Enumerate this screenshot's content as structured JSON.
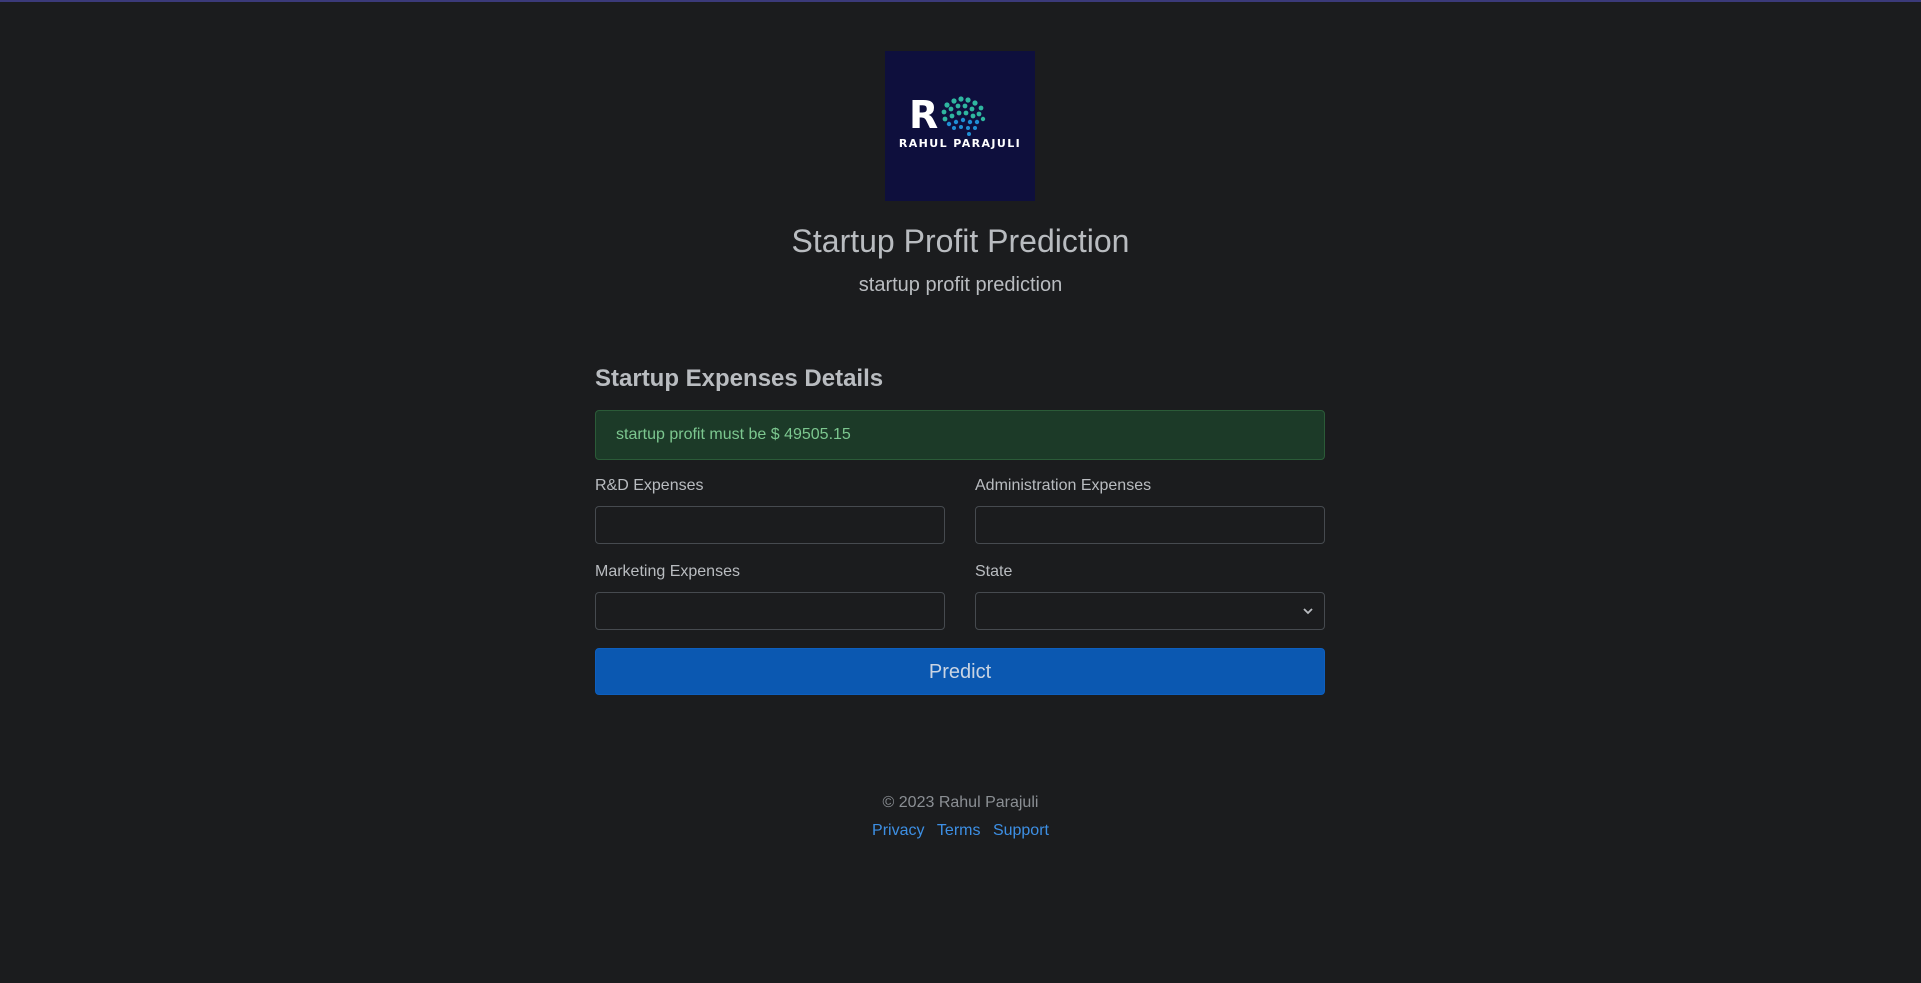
{
  "logo": {
    "letter": "R",
    "text": "RAHUL PARAJULI",
    "background": "#0e0f3d"
  },
  "header": {
    "title": "Startup Profit Prediction",
    "subtitle": "startup profit prediction"
  },
  "form": {
    "section_title": "Startup Expenses Details",
    "alert_text": "startup profit must be $ 49505.15",
    "fields": {
      "rd_label": "R&D Expenses",
      "rd_value": "",
      "admin_label": "Administration Expenses",
      "admin_value": "",
      "marketing_label": "Marketing Expenses",
      "marketing_value": "",
      "state_label": "State",
      "state_value": ""
    },
    "submit_label": "Predict"
  },
  "footer": {
    "copyright": "© 2023 Rahul Parajuli",
    "links": [
      "Privacy",
      "Terms",
      "Support"
    ]
  },
  "colors": {
    "background": "#1b1c1e",
    "primary_button": "#0b58b1",
    "alert_bg": "#1c3a28",
    "alert_text": "#7cc78f",
    "link": "#3d8fe4"
  }
}
